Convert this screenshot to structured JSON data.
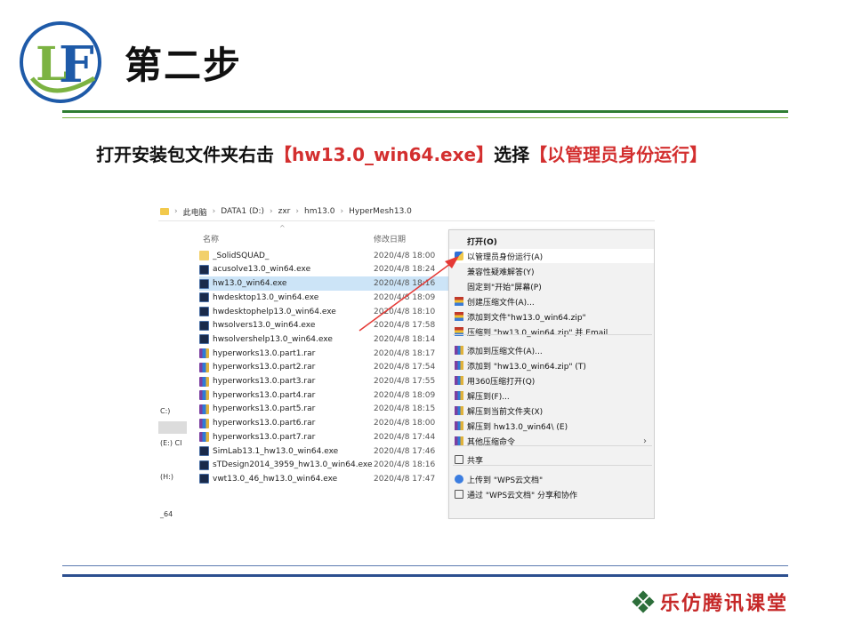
{
  "header": {
    "logo_text": "LF",
    "title": "第二步"
  },
  "instruction": {
    "part1": "打开安装包文件夹右击",
    "part2": "【hw13.0_win64.exe】",
    "part3": "选择",
    "part4": "【以管理员身份运行】"
  },
  "explorer": {
    "breadcrumb": [
      "此电脑",
      "DATA1 (D:)",
      "zxr",
      "hm13.0",
      "HyperMesh13.0"
    ],
    "columns": {
      "name": "名称",
      "date": "修改日期"
    },
    "left_nav": [
      "C:)",
      "(E:) CI",
      "(H:)",
      "_64"
    ],
    "files": [
      {
        "name": "_SolidSQUAD_",
        "date": "2020/4/8 18:00",
        "type": "folder"
      },
      {
        "name": "acusolve13.0_win64.exe",
        "date": "2020/4/8 18:24",
        "type": "exe"
      },
      {
        "name": "hw13.0_win64.exe",
        "date": "2020/4/8 18:16",
        "type": "exe",
        "selected": true
      },
      {
        "name": "hwdesktop13.0_win64.exe",
        "date": "2020/4/8 18:09",
        "type": "exe"
      },
      {
        "name": "hwdesktophelp13.0_win64.exe",
        "date": "2020/4/8 18:10",
        "type": "exe"
      },
      {
        "name": "hwsolvers13.0_win64.exe",
        "date": "2020/4/8 17:58",
        "type": "exe"
      },
      {
        "name": "hwsolvershelp13.0_win64.exe",
        "date": "2020/4/8 18:14",
        "type": "exe"
      },
      {
        "name": "hyperworks13.0.part1.rar",
        "date": "2020/4/8 18:17",
        "type": "rar"
      },
      {
        "name": "hyperworks13.0.part2.rar",
        "date": "2020/4/8 17:54",
        "type": "rar"
      },
      {
        "name": "hyperworks13.0.part3.rar",
        "date": "2020/4/8 17:55",
        "type": "rar"
      },
      {
        "name": "hyperworks13.0.part4.rar",
        "date": "2020/4/8 18:09",
        "type": "rar"
      },
      {
        "name": "hyperworks13.0.part5.rar",
        "date": "2020/4/8 18:15",
        "type": "rar"
      },
      {
        "name": "hyperworks13.0.part6.rar",
        "date": "2020/4/8 18:00",
        "type": "rar"
      },
      {
        "name": "hyperworks13.0.part7.rar",
        "date": "2020/4/8 17:44",
        "type": "rar"
      },
      {
        "name": "SimLab13.1_hw13.0_win64.exe",
        "date": "2020/4/8 17:46",
        "type": "exe"
      },
      {
        "name": "sTDesign2014_3959_hw13.0_win64.exe",
        "date": "2020/4/8 18:16",
        "type": "exe"
      },
      {
        "name": "vwt13.0_46_hw13.0_win64.exe",
        "date": "2020/4/8 17:47",
        "type": "exe"
      }
    ]
  },
  "context_menu": {
    "items": [
      {
        "label": "打开(O)",
        "icon": "none",
        "bold": true
      },
      {
        "label": "以管理员身份运行(A)",
        "icon": "uac-shield-icon",
        "highlighted": true
      },
      {
        "label": "兼容性疑难解答(Y)",
        "icon": "none"
      },
      {
        "label": "固定到\"开始\"屏幕(P)",
        "icon": "none"
      },
      {
        "label": "创建压缩文件(A)...",
        "icon": "winrar-icon"
      },
      {
        "label": "添加到文件\"hw13.0_win64.zip\"",
        "icon": "winrar-icon"
      },
      {
        "label": "压缩到 \"hw13.0_win64.zip\" 并 Email",
        "icon": "winrar-icon"
      },
      {
        "label": "添加到压缩文件(A)...",
        "icon": "rar-icon"
      },
      {
        "label": "添加到 \"hw13.0_win64.zip\" (T)",
        "icon": "rar-icon"
      },
      {
        "label": "用360压缩打开(Q)",
        "icon": "rar-icon"
      },
      {
        "label": "解压到(F)...",
        "icon": "rar-icon"
      },
      {
        "label": "解压到当前文件夹(X)",
        "icon": "rar-icon"
      },
      {
        "label": "解压到 hw13.0_win64\\ (E)",
        "icon": "rar-icon"
      },
      {
        "label": "其他压缩命令",
        "icon": "rar-icon",
        "submenu": true
      },
      {
        "label": "共享",
        "icon": "share-icon"
      },
      {
        "label": "上传到 \"WPS云文档\"",
        "icon": "cloud-icon"
      },
      {
        "label": "通过 \"WPS云文档\" 分享和协作",
        "icon": "share-icon"
      }
    ],
    "submenu_arrow": "›"
  },
  "annotation": {
    "color": "#e53935"
  },
  "footer": {
    "brand": "乐仿腾讯课堂",
    "brand_color": "#c62828"
  },
  "colors": {
    "green_rule": "#2e7d32",
    "blue_rule": "#2c4f8f",
    "highlight_red": "#d32f2f",
    "selection": "#cce4f7"
  }
}
